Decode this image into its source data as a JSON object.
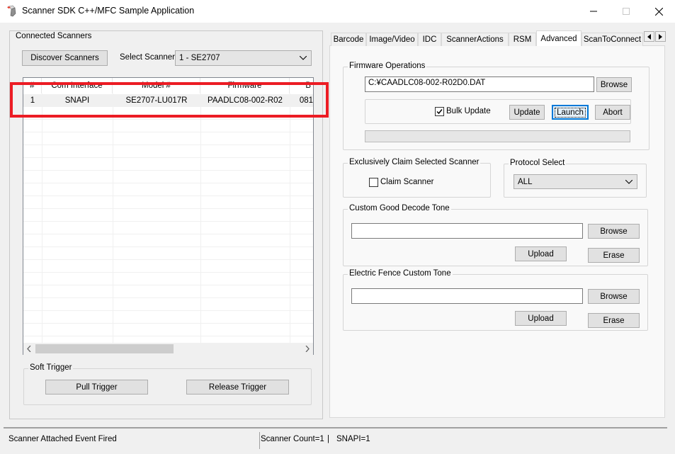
{
  "window": {
    "title": "Scanner SDK C++/MFC Sample Application"
  },
  "left": {
    "group_title": "Connected Scanners",
    "discover_label": "Discover Scanners",
    "select_label": "Select Scanner",
    "select_value": "1  -  SE2707",
    "columns": [
      "#",
      "Com Interface",
      "Model #",
      "Firmware",
      "B"
    ],
    "rows": [
      {
        "num": "1",
        "interface": "SNAPI",
        "model": "SE2707-LU017R",
        "firmware": "PAADLC08-002-R02",
        "extra": "081"
      }
    ],
    "soft_trigger": {
      "title": "Soft Trigger",
      "pull_label": "Pull Trigger",
      "release_label": "Release Trigger"
    }
  },
  "tabs": [
    "Barcode",
    "Image/Video",
    "IDC",
    "ScannerActions",
    "RSM",
    "Advanced",
    "ScanToConnect"
  ],
  "active_tab": "Advanced",
  "advanced": {
    "firmware": {
      "title": "Firmware Operations",
      "path": "C:¥CAADLC08-002-R02D0.DAT",
      "browse_label": "Browse",
      "bulk_label": "Bulk Update",
      "bulk_checked": true,
      "update_label": "Update",
      "launch_label": "Launch",
      "abort_label": "Abort",
      "progress": 0
    },
    "claim": {
      "title": "Exclusively Claim Selected Scanner",
      "checkbox_label": "Claim Scanner",
      "checked": false
    },
    "protocol": {
      "title": "Protocol Select",
      "value": "ALL"
    },
    "decode_tone": {
      "title": "Custom Good Decode Tone",
      "path": "",
      "browse_label": "Browse",
      "upload_label": "Upload",
      "erase_label": "Erase"
    },
    "fence_tone": {
      "title": "Electric Fence Custom Tone",
      "path": "",
      "browse_label": "Browse",
      "upload_label": "Upload",
      "erase_label": "Erase"
    }
  },
  "status": {
    "left": "Scanner Attached Event Fired",
    "count": "Scanner Count=1",
    "sep": "|",
    "snapi": "SNAPI=1"
  },
  "colors": {
    "highlight": "#ec1c24",
    "focus_border": "#0078d7"
  }
}
